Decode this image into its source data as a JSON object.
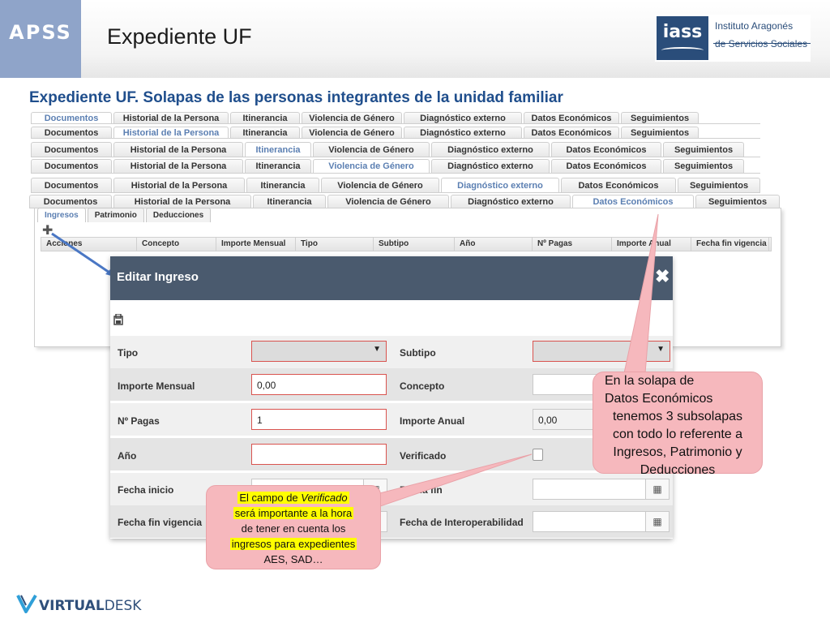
{
  "header": {
    "apss": "APSS",
    "title": "Expediente UF",
    "iass_brand": "iass",
    "iass_name_1": "Instituto Aragonés",
    "iass_name_2": "de Servicios Sociales"
  },
  "subtitle": "Expediente UF. Solapas de las personas integrantes de la unidad familiar",
  "tab_rows": [
    {
      "tabs": [
        "Documentos",
        "Historial de la Persona",
        "Itinerancia",
        "Violencia de Género",
        "Diagnóstico externo",
        "Datos Económicos",
        "Seguimientos"
      ],
      "active": 0
    },
    {
      "tabs": [
        "Documentos",
        "Historial de la Persona",
        "Itinerancia",
        "Violencia de Género",
        "Diagnóstico externo",
        "Datos Económicos",
        "Seguimientos"
      ],
      "active": 1
    },
    {
      "tabs": [
        "Documentos",
        "Historial de la Persona",
        "Itinerancia",
        "Violencia de Género",
        "Diagnóstico externo",
        "Datos Económicos",
        "Seguimientos"
      ],
      "active": 2
    },
    {
      "tabs": [
        "Documentos",
        "Historial de la Persona",
        "Itinerancia",
        "Violencia de Género",
        "Diagnóstico externo",
        "Datos Económicos",
        "Seguimientos"
      ],
      "active": 3
    },
    {
      "tabs": [
        "Documentos",
        "Historial de la Persona",
        "Itinerancia",
        "Violencia de Género",
        "Diagnóstico externo",
        "Datos Económicos",
        "Seguimientos"
      ],
      "active": 4
    },
    {
      "tabs": [
        "Documentos",
        "Historial de la Persona",
        "Itinerancia",
        "Violencia de Género",
        "Diagnóstico externo",
        "Datos Económicos",
        "Seguimientos"
      ],
      "active": 5
    }
  ],
  "subtabs": [
    "Ingresos",
    "Patrimonio",
    "Deducciones"
  ],
  "grid_columns": [
    "Acciones",
    "Concepto",
    "Importe Mensual",
    "Tipo",
    "Subtipo",
    "Año",
    "Nº Pagas",
    "Importe Anual",
    "Fecha fin vigencia"
  ],
  "modal": {
    "title": "Editar Ingreso",
    "close": "✖",
    "fields": {
      "tipo_label": "Tipo",
      "tipo_arrow": "▼",
      "subtipo_label": "Subtipo",
      "subtipo_arrow": "▼",
      "importe_mensual_label": "Importe Mensual",
      "importe_mensual_value": "0,00",
      "concepto_label": "Concepto",
      "concepto_value": "",
      "num_pagas_label": "Nº Pagas",
      "num_pagas_value": "1",
      "importe_anual_label": "Importe Anual",
      "importe_anual_value": "0,00",
      "anio_label": "Año",
      "anio_value": "",
      "verificado_label": "Verificado",
      "fecha_inicio_label": "Fecha inicio",
      "fecha_fin_label": "Fecha fin",
      "fecha_fin_vigencia_label": "Fecha fin vigencia",
      "fecha_interop_label": "Fecha de Interoperabilidad"
    }
  },
  "callouts": {
    "econ_1": "En la solapa de",
    "econ_2": "Datos Económicos",
    "econ_3": "tenemos 3 subsolapas",
    "econ_4": "con todo lo referente a",
    "econ_5": "Ingresos, Patrimonio y",
    "econ_6": "Deducciones",
    "ver_1a": "El campo de ",
    "ver_1b": "Verificado",
    "ver_2": "será importante a la hora",
    "ver_3": "de tener en cuenta los",
    "ver_4": "ingresos para expedientes",
    "ver_5": "AES, SAD…"
  },
  "footer": {
    "brand_1": "VIRTUAL",
    "brand_2": "DESK"
  },
  "colors": {
    "accent": "#1f4e8c",
    "modal_header": "#4a5a6e",
    "callout": "#f6b8bd",
    "required": "#d9534f"
  }
}
